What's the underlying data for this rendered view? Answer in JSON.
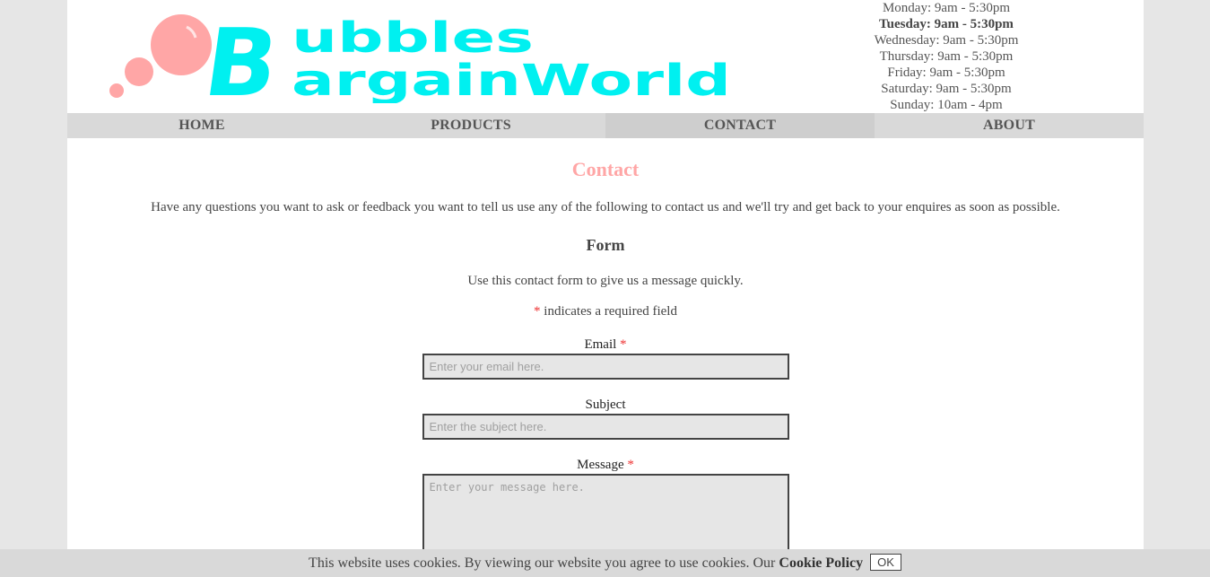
{
  "brand": {
    "logo_line1": "ubbles",
    "logo_line2": "argainWorld",
    "logo_initial": "B",
    "text_color": "#00f0f0",
    "bubble_color": "#ffa6a6"
  },
  "hours": [
    "Monday: 9am - 5:30pm",
    "Tuesday: 9am - 5:30pm",
    "Wednesday: 9am - 5:30pm",
    "Thursday: 9am - 5:30pm",
    "Friday: 9am - 5:30pm",
    "Saturday: 9am - 5:30pm",
    "Sunday: 10am - 4pm"
  ],
  "nav": {
    "items": [
      {
        "label": "HOME"
      },
      {
        "label": "PRODUCTS"
      },
      {
        "label": "CONTACT",
        "active": true
      },
      {
        "label": "ABOUT"
      }
    ]
  },
  "content": {
    "title": "Contact",
    "intro": "Have any questions you want to ask or feedback you want to tell us use any of the following to contact us and we'll try and get back to your enquires as soon as possible.",
    "form_heading": "Form",
    "form_desc": "Use this contact form to give us a message quickly.",
    "required_star": "*",
    "required_note": " indicates a required field"
  },
  "form": {
    "email_label": "Email",
    "email_placeholder": "Enter your email here.",
    "subject_label": "Subject",
    "subject_placeholder": "Enter the subject here.",
    "message_label": "Message",
    "message_placeholder": "Enter your message here."
  },
  "cookie": {
    "text": "This website uses cookies. By viewing our website you agree to use cookies. Our ",
    "policy_link": "Cookie Policy",
    "ok_label": "OK"
  },
  "colors": {
    "accent": "#ffa6a6",
    "nav_bg": "#d9d9d9",
    "required": "#ee3333"
  }
}
